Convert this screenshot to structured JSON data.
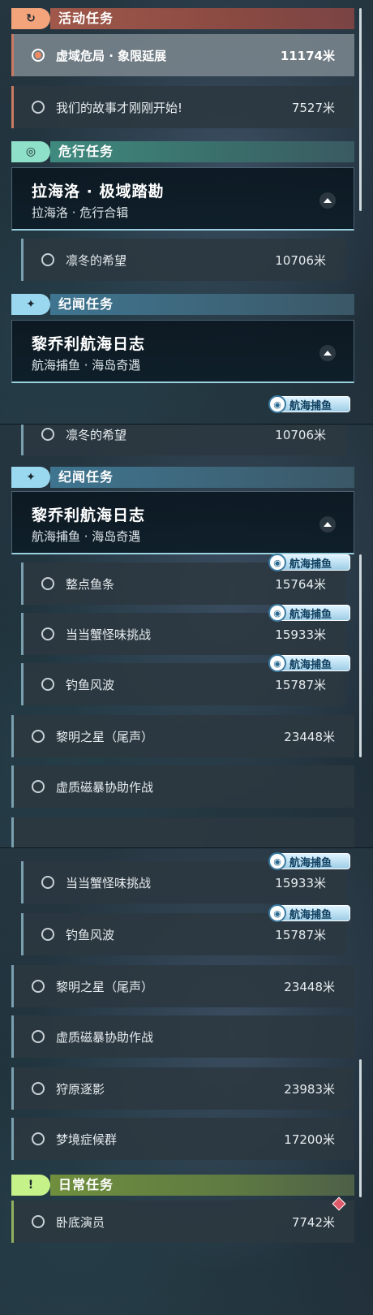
{
  "categories": {
    "event": {
      "label": "活动任务",
      "icon": "event-quest-icon",
      "color": "#f4a47a"
    },
    "danger": {
      "label": "危行任务",
      "icon": "danger-quest-icon",
      "color": "#8ee0c8"
    },
    "chronicle": {
      "label": "纪闻任务",
      "icon": "chronicle-quest-icon",
      "color": "#9ad8f0"
    },
    "daily": {
      "label": "日常任务",
      "icon": "daily-quest-icon",
      "color": "#c6f28a"
    }
  },
  "quests": {
    "void_peril": {
      "name": "虚域危局 · 象限延展",
      "distance": "11174米"
    },
    "our_story": {
      "name": "我们的故事才刚刚开始!",
      "distance": "7527米"
    },
    "winter_hope": {
      "name": "凛冬的希望",
      "distance": "10706米"
    },
    "hourly_fish": {
      "name": "整点鱼条",
      "distance": "15764米"
    },
    "crab_challenge": {
      "name": "当当蟹怪味挑战",
      "distance": "15933米"
    },
    "fishing_storm": {
      "name": "钓鱼风波",
      "distance": "15787米"
    },
    "dawn_star": {
      "name": "黎明之星（尾声）",
      "distance": "23448米"
    },
    "magstorm": {
      "name": "虚质磁暴协助作战",
      "distance": ""
    },
    "hunting_shadow": {
      "name": "狩原逐影",
      "distance": "23983米"
    },
    "dream_syndrome": {
      "name": "梦境症候群",
      "distance": "17200米"
    },
    "bottom_actor": {
      "name": "卧底演员",
      "distance": "7742米"
    }
  },
  "chains": {
    "lahailuo": {
      "title": "拉海洛 · 极域踏勘",
      "subtitle": "拉海洛 · 危行合辑"
    },
    "liqiao": {
      "title": "黎乔利航海日志",
      "subtitle": "航海捕鱼 · 海岛奇遇"
    }
  },
  "badge": {
    "label": "航海捕鱼",
    "icon": "fishing-icon"
  },
  "selected_quest": "void_peril"
}
